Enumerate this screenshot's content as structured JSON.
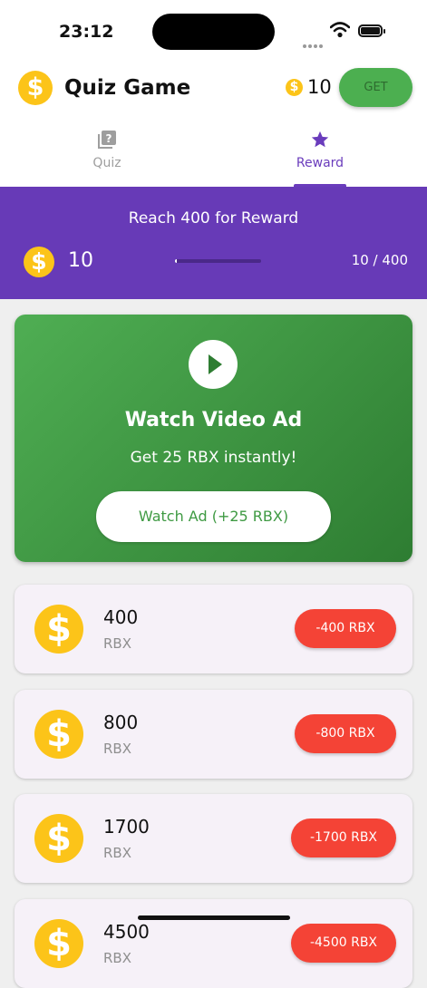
{
  "status": {
    "time": "23:12"
  },
  "appbar": {
    "logo_symbol": "$",
    "title": "Quiz Game",
    "balance_symbol": "$",
    "balance": "10",
    "get_label": "GET"
  },
  "tabs": [
    {
      "label": "Quiz",
      "icon": "quiz-icon",
      "active": false
    },
    {
      "label": "Reward",
      "icon": "star-icon",
      "active": true
    }
  ],
  "banner": {
    "title": "Reach 400 for Reward",
    "coin_symbol": "$",
    "count": "10",
    "progress_text": "10 / 400",
    "progress_fraction": 0.025
  },
  "ad": {
    "title": "Watch Video Ad",
    "subtitle": "Get 25 RBX instantly!",
    "button": "Watch Ad (+25 RBX)"
  },
  "rewards": [
    {
      "amount": "400",
      "unit": "RBX",
      "symbol": "$",
      "button": "-400 RBX"
    },
    {
      "amount": "800",
      "unit": "RBX",
      "symbol": "$",
      "button": "-800 RBX"
    },
    {
      "amount": "1700",
      "unit": "RBX",
      "symbol": "$",
      "button": "-1700 RBX"
    },
    {
      "amount": "4500",
      "unit": "RBX",
      "symbol": "$",
      "button": "-4500 RBX"
    }
  ],
  "colors": {
    "primary": "#673ab7",
    "accent_green": "#4caf50",
    "coin": "#fcc419",
    "redeem": "#f44336"
  }
}
